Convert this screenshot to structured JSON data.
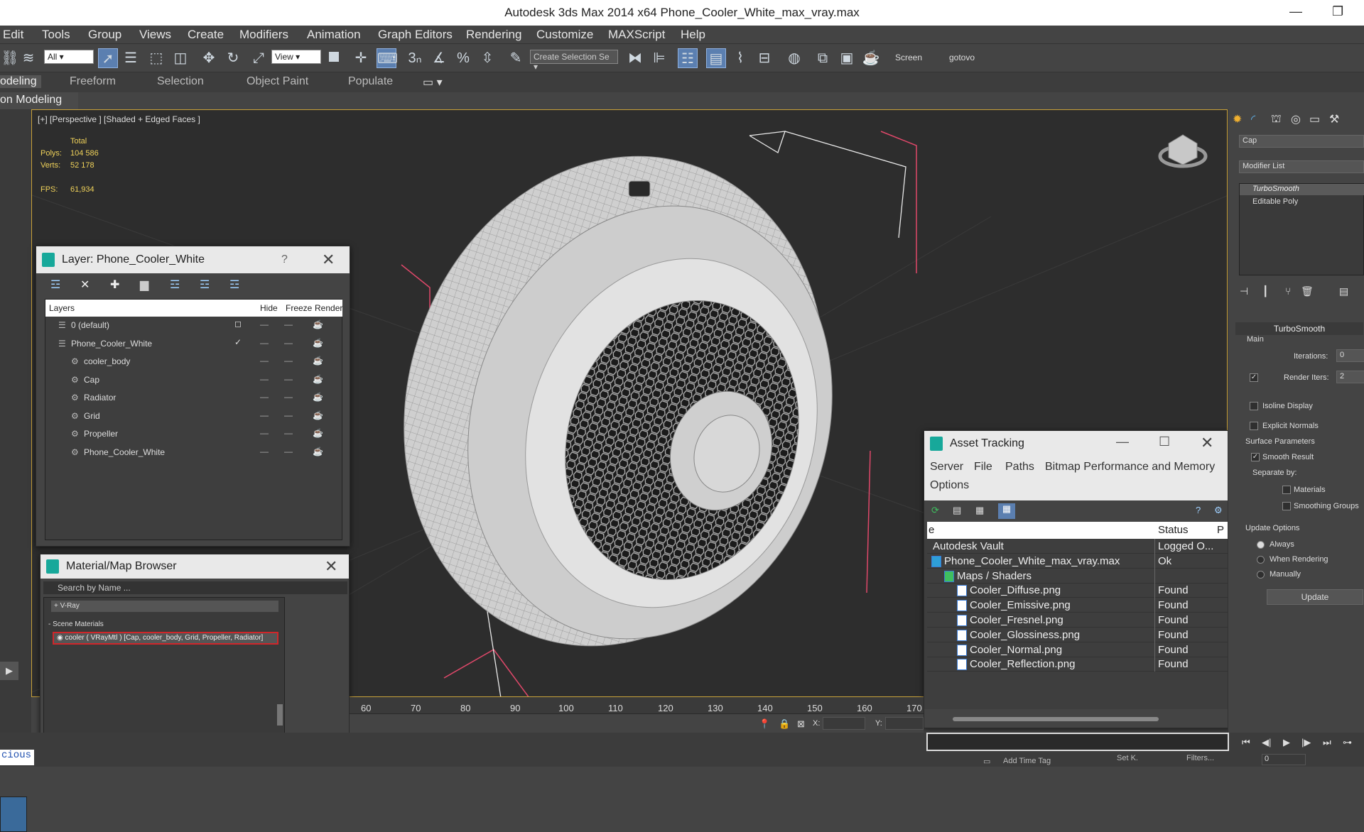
{
  "app": {
    "title": "Autodesk 3ds Max  2014 x64      Phone_Cooler_White_max_vray.max",
    "min_icon": "minimize-icon",
    "restore_icon": "restore-icon"
  },
  "menu": [
    "Edit",
    "Tools",
    "Group",
    "Views",
    "Create",
    "Modifiers",
    "Animation",
    "Graph Editors",
    "Rendering",
    "Customize",
    "MAXScript",
    "Help"
  ],
  "toolbar": {
    "filter_value": "All",
    "refcoord_value": "View",
    "selection_set_placeholder": "Create Selection Se",
    "snap_label": "3",
    "screen_label": "Screen",
    "gotovo_label": "gotovo"
  },
  "ribbon": {
    "tabs": [
      "odeling",
      "Freeform",
      "Selection",
      "Object Paint",
      "Populate"
    ],
    "subtab": "on Modeling"
  },
  "viewport": {
    "label": "[+] [Perspective ] [Shaded + Edged Faces ]",
    "stats": {
      "total_label": "Total",
      "polys_label": "Polys:",
      "polys_value": "104 586",
      "verts_label": "Verts:",
      "verts_value": "52 178",
      "fps_label": "FPS:",
      "fps_value": "61,934"
    }
  },
  "layer_window": {
    "title": "Layer: Phone_Cooler_White",
    "help": "?",
    "columns": {
      "layers": "Layers",
      "hide": "Hide",
      "freeze": "Freeze",
      "render": "Render"
    },
    "rows": [
      {
        "name": "0 (default)",
        "indent": 0,
        "marker": "box"
      },
      {
        "name": "Phone_Cooler_White",
        "indent": 0,
        "marker": "check"
      },
      {
        "name": "cooler_body",
        "indent": 1,
        "marker": ""
      },
      {
        "name": "Cap",
        "indent": 1,
        "marker": ""
      },
      {
        "name": "Radiator",
        "indent": 1,
        "marker": ""
      },
      {
        "name": "Grid",
        "indent": 1,
        "marker": ""
      },
      {
        "name": "Propeller",
        "indent": 1,
        "marker": ""
      },
      {
        "name": "Phone_Cooler_White",
        "indent": 1,
        "marker": ""
      }
    ]
  },
  "material_browser": {
    "title": "Material/Map Browser",
    "search_placeholder": "Search by Name ...",
    "group_vray": "+ V-Ray",
    "group_scene": "- Scene Materials",
    "scene_item": "cooler ( VRayMtl ) [Cap, cooler_body, Grid, Propeller, Radiator]"
  },
  "asset_tracking": {
    "title": "Asset Tracking",
    "menu": [
      "Server",
      "File",
      "Paths",
      "Bitmap Performance and Memory",
      "Options"
    ],
    "col_name": "e",
    "col_status": "Status",
    "col_extra": "P",
    "rows": [
      {
        "name": "Autodesk Vault",
        "status": "Logged O...",
        "indent": 0,
        "icon": "vault"
      },
      {
        "name": "Phone_Cooler_White_max_vray.max",
        "status": "Ok",
        "indent": 0,
        "icon": "max"
      },
      {
        "name": "Maps / Shaders",
        "status": "",
        "indent": 1,
        "icon": "folder"
      },
      {
        "name": "Cooler_Diffuse.png",
        "status": "Found",
        "indent": 2,
        "icon": "file"
      },
      {
        "name": "Cooler_Emissive.png",
        "status": "Found",
        "indent": 2,
        "icon": "file"
      },
      {
        "name": "Cooler_Fresnel.png",
        "status": "Found",
        "indent": 2,
        "icon": "file"
      },
      {
        "name": "Cooler_Glossiness.png",
        "status": "Found",
        "indent": 2,
        "icon": "file"
      },
      {
        "name": "Cooler_Normal.png",
        "status": "Found",
        "indent": 2,
        "icon": "file"
      },
      {
        "name": "Cooler_Reflection.png",
        "status": "Found",
        "indent": 2,
        "icon": "file"
      }
    ]
  },
  "command_panel": {
    "object_name": "Cap",
    "modifier_list": "Modifier List",
    "stack": [
      "TurboSmooth",
      "Editable Poly"
    ],
    "rollout_title": "TurboSmooth",
    "main": "Main",
    "iterations_label": "Iterations:",
    "iterations_value": "0",
    "render_iters_label": "Render Iters:",
    "render_iters_value": "2",
    "isoline": "Isoline Display",
    "explicit": "Explicit Normals",
    "surface_params": "Surface Parameters",
    "smooth_result": "Smooth Result",
    "separate_by": "Separate by:",
    "materials": "Materials",
    "smoothing_groups": "Smoothing Groups",
    "update_options": "Update Options",
    "always": "Always",
    "when_rendering": "When Rendering",
    "manually": "Manually",
    "update_button": "Update"
  },
  "timeline": {
    "ticks": [
      "60",
      "70",
      "80",
      "90",
      "100",
      "110",
      "120",
      "130",
      "140",
      "150",
      "160",
      "170"
    ],
    "x_label": "X:",
    "y_label": "Y:"
  },
  "bottom": {
    "script_text": "cious",
    "add_time_tag": "Add Time Tag",
    "set_k": "Set K.",
    "filters": "Filters...",
    "frame_value": "0"
  },
  "colors": {
    "viewport_border": "#c9a23a",
    "stats_yellow": "#f0d25a",
    "accent_blue": "#5b7fb0",
    "material_red": "#d0262a"
  }
}
